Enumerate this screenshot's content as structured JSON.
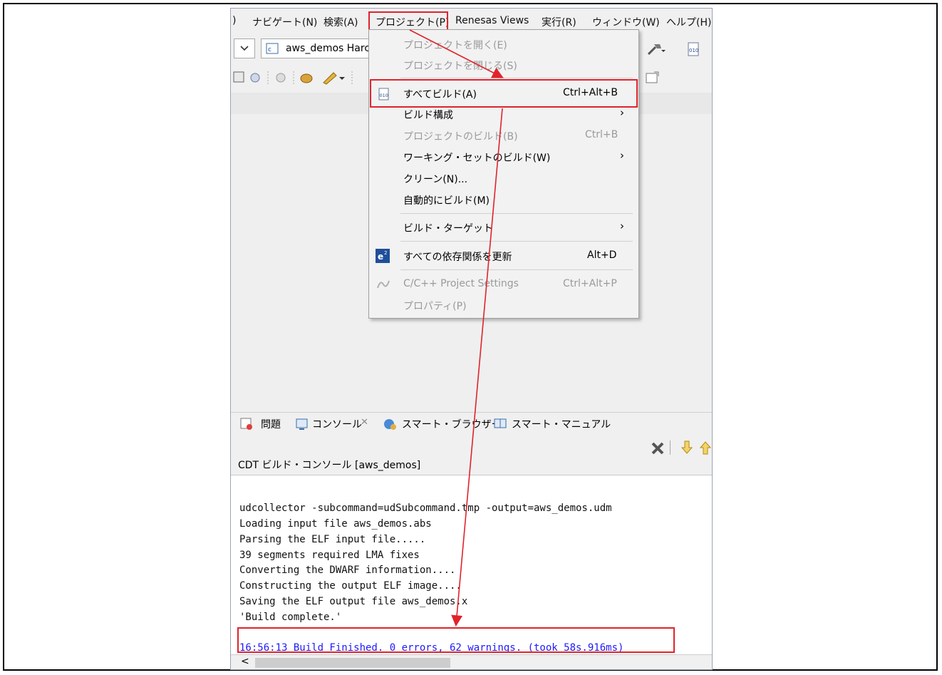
{
  "menubar": {
    "items": [
      {
        "label": ")"
      },
      {
        "label": "ナビゲート(N)"
      },
      {
        "label": "検索(A)"
      },
      {
        "label": "プロジェクト(P)"
      },
      {
        "label": "Renesas Views"
      },
      {
        "label": "実行(R)"
      },
      {
        "label": "ウィンドウ(W)"
      },
      {
        "label": "ヘルプ(H)"
      }
    ]
  },
  "toolbar": {
    "launch_config": "aws_demos Harc"
  },
  "project_menu": {
    "items": [
      {
        "label": "プロジェクトを開く(E)",
        "shortcut": "",
        "enabled": false
      },
      {
        "label": "プロジェクトを閉じる(S)",
        "shortcut": "",
        "enabled": false
      },
      {
        "label": "すべてビルド(A)",
        "shortcut": "Ctrl+Alt+B",
        "enabled": true
      },
      {
        "label": "ビルド構成",
        "shortcut": "",
        "enabled": true
      },
      {
        "label": "プロジェクトのビルド(B)",
        "shortcut": "Ctrl+B",
        "enabled": false
      },
      {
        "label": "ワーキング・セットのビルド(W)",
        "shortcut": "",
        "enabled": true
      },
      {
        "label": "クリーン(N)...",
        "shortcut": "",
        "enabled": true
      },
      {
        "label": "自動的にビルド(M)",
        "shortcut": "",
        "enabled": true
      },
      {
        "label": "ビルド・ターゲット",
        "shortcut": "",
        "enabled": true
      },
      {
        "label": "すべての依存関係を更新",
        "shortcut": "Alt+D",
        "enabled": true
      },
      {
        "label": "C/C++ Project Settings",
        "shortcut": "Ctrl+Alt+P",
        "enabled": false
      },
      {
        "label": "プロパティ(P)",
        "shortcut": "",
        "enabled": false
      }
    ],
    "submenu_arrow": "›"
  },
  "bottom_tabs": [
    {
      "label": "問題"
    },
    {
      "label": "コンソール"
    },
    {
      "label": "スマート・ブラウザー"
    },
    {
      "label": "スマート・マニュアル"
    }
  ],
  "console": {
    "title": "CDT ビルド・コンソール [aws_demos]",
    "lines": [
      "udcollector -subcommand=udSubcommand.tmp -output=aws_demos.udm",
      "Loading input file aws_demos.abs",
      "Parsing the ELF input file.....",
      "39 segments required LMA fixes",
      "Converting the DWARF information....",
      "Constructing the output ELF image....",
      "Saving the ELF output file aws_demos.x",
      "'Build complete.'"
    ],
    "finish_line": "16:56:13 Build Finished. 0 errors, 62 warnings. (took 58s.916ms)"
  },
  "scroll_left": "<",
  "colors": {
    "highlight": "#e0232b",
    "finish_text": "#1a1aff"
  }
}
